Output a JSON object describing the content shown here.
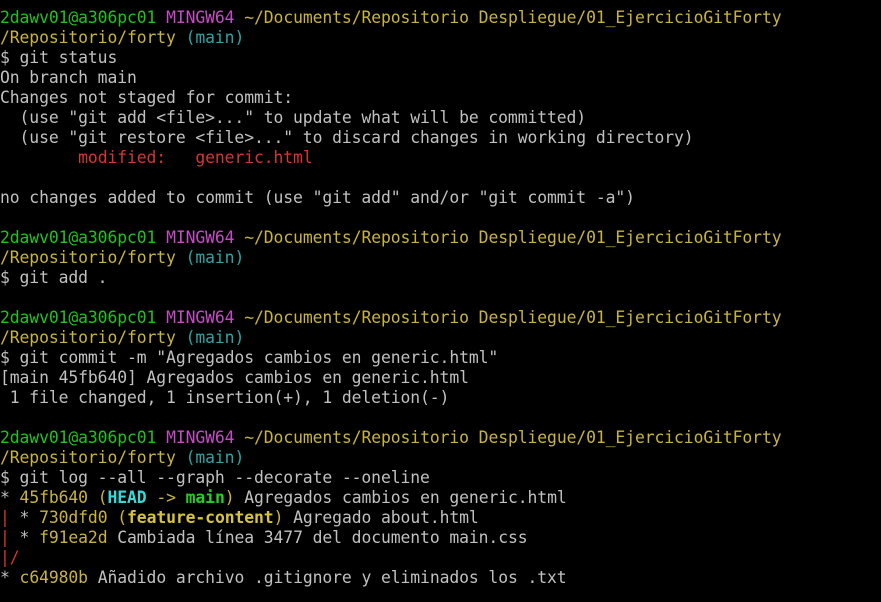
{
  "prompt": {
    "user": "2dawv01@a306pc01",
    "shell": "MINGW64",
    "path1": "~/Documents/Repositorio Despliegue/01_EjercicioGitForty",
    "path2": "/Repositorio/forty",
    "branch": "(main)"
  },
  "block1": {
    "cmd": "$ git status",
    "l1": "On branch main",
    "l2": "Changes not staged for commit:",
    "l3": "  (use \"git add <file>...\" to update what will be committed)",
    "l4": "  (use \"git restore <file>...\" to discard changes in working directory)",
    "modified_indent": "        ",
    "modified_label": "modified:   ",
    "modified_file": "generic.html",
    "l6": "no changes added to commit (use \"git add\" and/or \"git commit -a\")"
  },
  "block2": {
    "cmd": "$ git add ."
  },
  "block3": {
    "cmd": "$ git commit -m \"Agregados cambios en generic.html\"",
    "l1": "[main 45fb640] Agregados cambios en generic.html",
    "l2": " 1 file changed, 1 insertion(+), 1 deletion(-)"
  },
  "block4": {
    "cmd": "$ git log --all --graph --decorate --oneline",
    "log": [
      {
        "graph": "* ",
        "hash": "45fb640",
        "open": " (",
        "head": "HEAD",
        "arrow": " -> ",
        "ref": "main",
        "close": ")",
        "msg": " Agregados cambios en generic.html"
      },
      {
        "graph_pipe": "|",
        "graph_rest": " * ",
        "hash": "730dfd0",
        "open": " (",
        "ref": "feature-content",
        "close": ")",
        "msg": " Agregado about.html"
      },
      {
        "graph_pipe": "|",
        "graph_rest": " * ",
        "hash": "f91ea2d",
        "msg": " Cambiada línea 3477 del documento main.css"
      },
      {
        "graph_pipe": "|/"
      },
      {
        "graph": "* ",
        "hash": "c64980b",
        "msg": " Añadido archivo .gitignore y eliminados los .txt"
      }
    ]
  },
  "colors": {
    "background": "#000000",
    "text": "#c0c0c0",
    "user": "#1cc51c",
    "mingw": "#c44cc4",
    "path": "#c9b43a",
    "branch": "#2aa5a5",
    "modified": "#d43535",
    "head": "#39d8d8",
    "main_ref": "#23d023",
    "feature_ref": "#d6c43b"
  }
}
